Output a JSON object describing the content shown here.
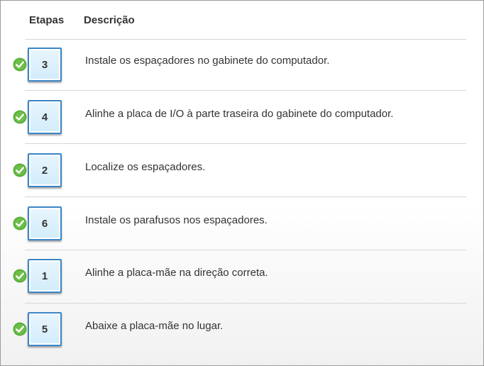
{
  "header": {
    "steps_label": "Etapas",
    "description_label": "Descrição"
  },
  "rows": [
    {
      "step": "3",
      "description": "Instale os espaçadores no gabinete do computador.",
      "status": "correct"
    },
    {
      "step": "4",
      "description": "Alinhe a placa de I/O à parte traseira do gabinete do computador.",
      "status": "correct"
    },
    {
      "step": "2",
      "description": "Localize os espaçadores.",
      "status": "correct"
    },
    {
      "step": "6",
      "description": "Instale os parafusos nos espaçadores.",
      "status": "correct"
    },
    {
      "step": "1",
      "description": "Alinhe a placa-mãe na direção correta.",
      "status": "correct"
    },
    {
      "step": "5",
      "description": "Abaixe a placa-mãe no lugar.",
      "status": "correct"
    }
  ],
  "colors": {
    "check_green": "#5cae3c",
    "tile_border": "#3a86c8",
    "tile_fill": "#d9effc",
    "divider": "#d6d6d6"
  },
  "icons": {
    "status": "checkmark-circle-icon"
  }
}
